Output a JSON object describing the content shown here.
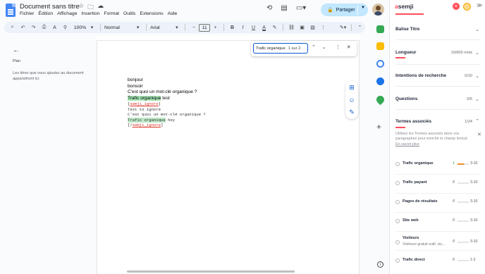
{
  "docs": {
    "title": "Document sans titre",
    "menu": [
      "Fichier",
      "Édition",
      "Affichage",
      "Insertion",
      "Format",
      "Outils",
      "Extensions",
      "Aide"
    ],
    "share_label": "Partager",
    "toolbar": {
      "zoom": "100%",
      "style": "Normal",
      "font": "Arial",
      "font_size": "11"
    },
    "outline": {
      "title": "Plan",
      "hint": "Les titres que vous ajoutez au document apparaîtront ici."
    },
    "find": {
      "query": "Trafic organique",
      "count": "1 sur 2"
    },
    "content": {
      "line1": "bonjour",
      "line2": "bonsoir",
      "line3": "C'est quoi un mot-clé organique ?",
      "line4_highlight": "Trafic organique",
      "line4_rest": " test",
      "mono1_open": "[",
      "mono1_tag": "semji_ignore",
      "mono1_close": "]",
      "mono2": "Test to ignore",
      "mono3": "C'est quoi un mot-clé organique ?",
      "mono4_highlight": "Trafic organique",
      "mono4_rest": " hey",
      "mono5_open": "[/",
      "mono5_tag": "semji_ignore",
      "mono5_close": "]"
    }
  },
  "semji": {
    "logo": "semji",
    "sections": {
      "balise": {
        "title": "Balise Titre"
      },
      "longueur": {
        "title": "Longueur",
        "meta": "10/600 mots"
      },
      "intentions": {
        "title": "Intentions de recherche",
        "meta": "0/10"
      },
      "questions": {
        "title": "Questions",
        "meta": "0/5"
      },
      "termes": {
        "title": "Termes associés",
        "meta": "1/24"
      }
    },
    "hint_text": "Utilisez les Termes associés dans vos paragraphes pour enrichir le champ lexical.",
    "hint_link": "En savoir plus",
    "terms": [
      {
        "name": "Trafic organique",
        "sub": "",
        "current": "1",
        "range": "3-10",
        "status": "partial"
      },
      {
        "name": "Trafic payant",
        "sub": "",
        "current": "0",
        "range": "3-10",
        "status": "none"
      },
      {
        "name": "Pages de résultats",
        "sub": "",
        "current": "0",
        "range": "3-10",
        "status": "none"
      },
      {
        "name": "Site web",
        "sub": "",
        "current": "0",
        "range": "3-10",
        "status": "none"
      },
      {
        "name": "Visiteurs",
        "sub": "Visiteurs gratuit outil, vis...",
        "current": "0",
        "range": "3-10",
        "status": "none"
      },
      {
        "name": "Trafic direct",
        "sub": "",
        "current": "0",
        "range": "1-2",
        "status": "none"
      }
    ],
    "colors": {
      "accent": "#ff4d5a",
      "progress": "#f28c28"
    }
  }
}
